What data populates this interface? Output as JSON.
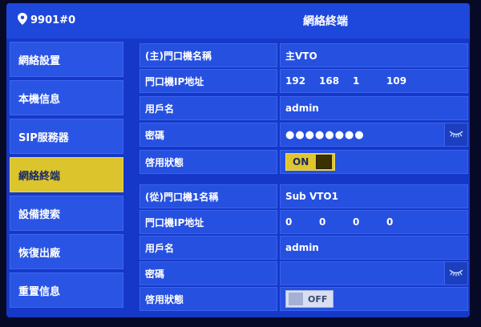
{
  "header": {
    "room_number": "9901#0",
    "title": "網絡終端"
  },
  "sidebar": {
    "items": [
      {
        "label": "網絡設置"
      },
      {
        "label": "本機信息"
      },
      {
        "label": "SIP服務器"
      },
      {
        "label": "網絡終端"
      },
      {
        "label": "設備搜索"
      },
      {
        "label": "恢復出廠"
      },
      {
        "label": "重置信息"
      }
    ],
    "active_index": 3
  },
  "main_vto": {
    "name_label": "(主)門口機名稱",
    "name_value": "主VTO",
    "ip_label": "門口機IP地址",
    "ip": [
      "192",
      "168",
      "1",
      "109"
    ],
    "user_label": "用戶名",
    "user_value": "admin",
    "password_label": "密碼",
    "password_value": "●●●●●●●●",
    "status_label": "啓用狀態",
    "status_value": "ON"
  },
  "sub_vto": {
    "name_label": "(從)門口機1名稱",
    "name_value": "Sub VTO1",
    "ip_label": "門口機IP地址",
    "ip": [
      "0",
      "0",
      "0",
      "0"
    ],
    "user_label": "用戶名",
    "user_value": "admin",
    "password_label": "密碼",
    "password_value": "",
    "status_label": "啓用狀態",
    "status_value": "OFF"
  },
  "colors": {
    "background": "#1638c8",
    "accent": "#dcc52c"
  }
}
